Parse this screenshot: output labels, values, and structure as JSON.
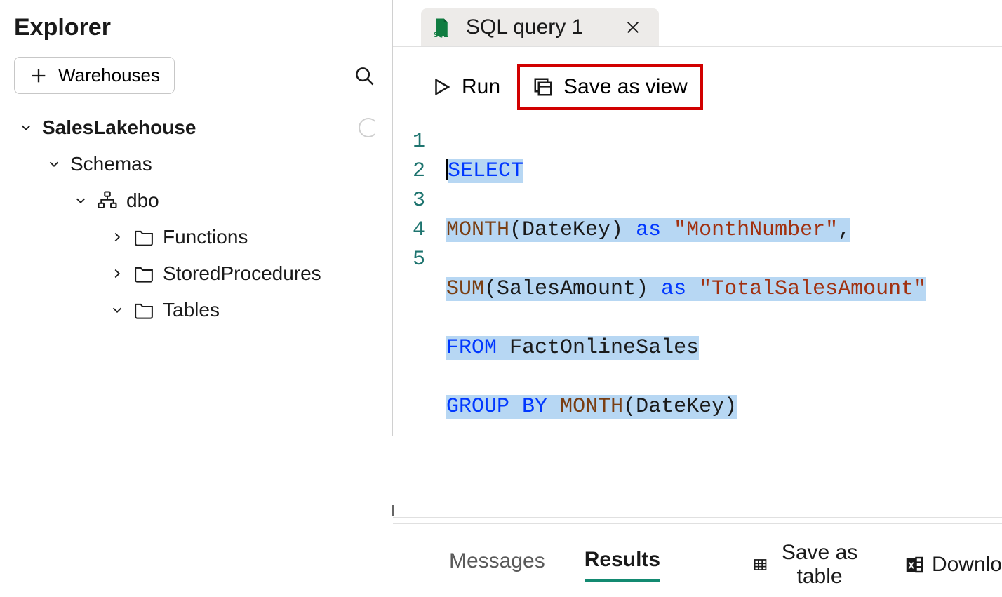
{
  "explorer": {
    "title": "Explorer",
    "add_label": "Warehouses",
    "database": "SalesLakehouse",
    "schemas_label": "Schemas",
    "schema_name": "dbo",
    "folders": {
      "functions": "Functions",
      "storedprocs": "StoredProcedures",
      "tables": "Tables"
    }
  },
  "tab": {
    "label": "SQL query 1"
  },
  "toolbar": {
    "run": "Run",
    "save_view": "Save as view"
  },
  "code": {
    "lines": [
      "1",
      "2",
      "3",
      "4",
      "5"
    ],
    "l1_kw": "SELECT",
    "l2_fn": "MONTH",
    "l2_txt1": "(DateKey) ",
    "l2_as": "as",
    "l2_sp": " ",
    "l2_str": "\"MonthNumber\"",
    "l2_c": ",",
    "l3_fn": "SUM",
    "l3_txt1": "(SalesAmount) ",
    "l3_as": "as",
    "l3_sp": " ",
    "l3_str": "\"TotalSalesAmount\"",
    "l4_kw": "FROM",
    "l4_txt": " FactOnlineSales",
    "l5_kw1": "GROUP",
    "l5_sp1": " ",
    "l5_kw2": "BY",
    "l5_sp2": " ",
    "l5_fn": "MONTH",
    "l5_txt": "(DateKey)"
  },
  "results": {
    "messages": "Messages",
    "results": "Results",
    "save_table": "Save as table",
    "download": "Downlo"
  }
}
